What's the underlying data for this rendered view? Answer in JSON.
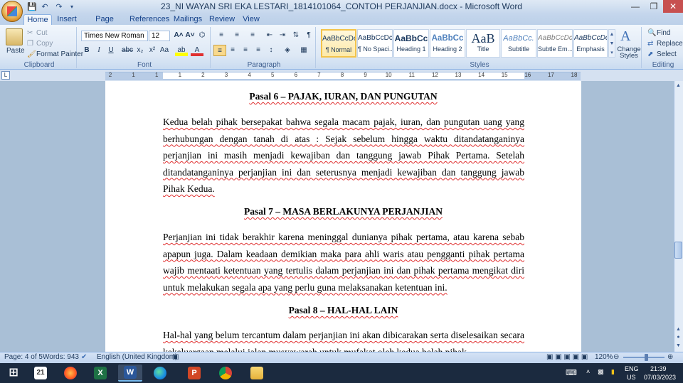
{
  "window": {
    "title": "23_NI WAYAN SRI EKA LESTARI_1814101064_CONTOH PERJANJIAN.docx - Microsoft Word"
  },
  "tabs": [
    "Home",
    "Insert",
    "Page Layout",
    "References",
    "Mailings",
    "Review",
    "View"
  ],
  "ribbon": {
    "clipboard": {
      "paste": "Paste",
      "cut": "Cut",
      "copy": "Copy",
      "format_painter": "Format Painter",
      "label": "Clipboard"
    },
    "font": {
      "name": "Times New Roman",
      "size": "12",
      "label": "Font"
    },
    "paragraph": {
      "label": "Paragraph"
    },
    "styles": {
      "label": "Styles",
      "items": [
        {
          "preview": "AaBbCcDc",
          "name": "¶ Normal"
        },
        {
          "preview": "AaBbCcDc",
          "name": "¶ No Spaci..."
        },
        {
          "preview": "AaBbCc",
          "name": "Heading 1"
        },
        {
          "preview": "AaBbCc",
          "name": "Heading 2"
        },
        {
          "preview": "AaB",
          "name": "Title"
        },
        {
          "preview": "AaBbCc.",
          "name": "Subtitle"
        },
        {
          "preview": "AaBbCcDc",
          "name": "Subtle Em..."
        },
        {
          "preview": "AaBbCcDc",
          "name": "Emphasis"
        }
      ],
      "change_styles": "Change Styles"
    },
    "editing": {
      "find": "Find",
      "replace": "Replace",
      "select": "Select",
      "label": "Editing"
    }
  },
  "ruler": {
    "numbers": [
      "2",
      "1",
      "1",
      "1",
      "2",
      "3",
      "4",
      "5",
      "6",
      "7",
      "8",
      "9",
      "10",
      "11",
      "12",
      "13",
      "14",
      "15",
      "16",
      "17",
      "18"
    ]
  },
  "document": {
    "h6": "Pasal 6 – PAJAK, IURAN, DAN PUNGUTAN",
    "p6": [
      "Kedua belah pihak bersepakat bahwa segala macam pajak, iuran, dan pungutan uang yang",
      "berhubungan dengan tanah di atas : Sejak sebelum hingga waktu ditandatanganinya",
      "perjanjian ini masih menjadi kewajiban dan tanggung jawab Pihak Pertama. Setelah",
      "ditandatanganinya perjanjian ini dan seterusnya menjadi kewajiban dan tanggung jawab",
      "Pihak Kedua."
    ],
    "h7": "Pasal 7 – MASA BERLAKUNYA PERJANJIAN",
    "p7": [
      "Perjanjian ini tidak berakhir karena meninggal dunianya pihak pertama, atau karena sebab",
      "apapun juga. Dalam keadaan demikian maka para ahli waris atau pengganti pihak pertama",
      "wajib mentaati ketentuan yang tertulis dalam perjanjian ini dan pihak pertama mengikat diri",
      "untuk melakukan segala apa yang perlu guna melaksanakan ketentuan ini."
    ],
    "h8": "Pasal 8 – HAL-HAL LAIN",
    "p8": [
      "Hal-hal yang belum tercantum dalam perjanjian ini akan dibicarakan serta diselesaikan secara",
      "kekeluargaan melalui jalan musyawarah untuk mufakat oleh kedua belah pihak."
    ]
  },
  "status": {
    "page": "Page: 4 of 5",
    "words": "Words: 943",
    "language": "English (United Kingdom)",
    "zoom": "120%"
  },
  "taskbar": {
    "lang": "ENG",
    "region": "US",
    "time": "21:39",
    "date": "07/03/2023",
    "calendar_day": "21"
  }
}
